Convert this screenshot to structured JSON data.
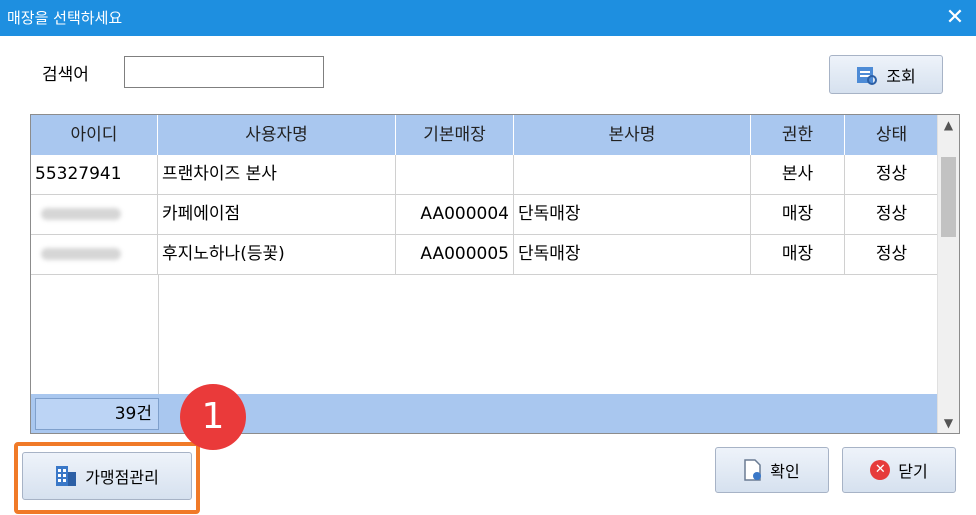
{
  "window": {
    "title": "매장을 선택하세요",
    "close_glyph": "✕"
  },
  "search": {
    "label": "검색어",
    "value": "",
    "placeholder": "",
    "button_label": "조회"
  },
  "grid": {
    "columns": [
      "아이디",
      "사용자명",
      "기본매장",
      "본사명",
      "권한",
      "상태"
    ],
    "rows": [
      {
        "id": "55327941",
        "user": "프랜차이즈 본사",
        "store": "",
        "hq": "",
        "role": "본사",
        "status": "정상"
      },
      {
        "id": "",
        "user": "카페에이점",
        "store": "AA000004",
        "hq": "단독매장",
        "role": "매장",
        "status": "정상"
      },
      {
        "id": "",
        "user": "후지노하나(등꽃)",
        "store": "AA000005",
        "hq": "단독매장",
        "role": "매장",
        "status": "정상"
      }
    ],
    "count": "39건"
  },
  "buttons": {
    "franchise_label": "가맹점관리",
    "ok_label": "확인",
    "close_label": "닫기"
  },
  "annotation": {
    "badge_number": "1"
  },
  "colors": {
    "titlebar": "#1e8fe0",
    "grid_header": "#a9c7ef",
    "highlight": "#f07a28",
    "badge": "#ea3a3a"
  }
}
